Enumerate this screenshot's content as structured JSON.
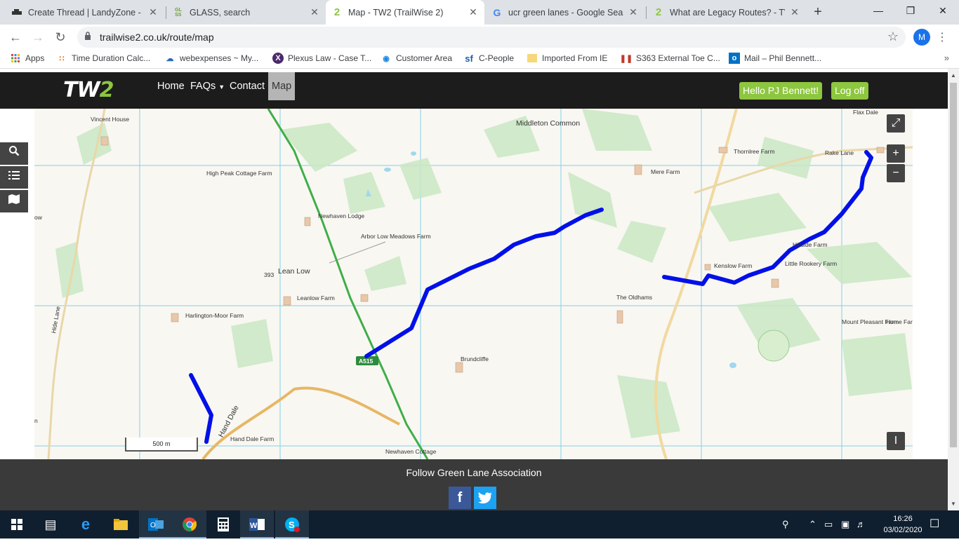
{
  "browser": {
    "tabs": [
      {
        "icon": "landrover-icon",
        "title": "Create Thread | LandyZone - La",
        "close": "✕"
      },
      {
        "icon": "glass-icon",
        "title": "GLASS, search",
        "close": "✕"
      },
      {
        "icon": "tw2-icon",
        "title": "Map - TW2 (TrailWise 2)",
        "close": "✕"
      },
      {
        "icon": "google-icon",
        "title": "ucr green lanes - Google Searc",
        "close": "✕"
      },
      {
        "icon": "tw2-icon",
        "title": "What are Legacy Routes? - TW",
        "close": "✕"
      }
    ],
    "new_tab": "+",
    "url": "trailwise2.co.uk/route/map",
    "profile_initial": "M",
    "bookmarks": [
      "Apps",
      "Time Duration Calc...",
      "webexpenses ~ My...",
      "Plexus Law - Case T...",
      "Customer Area",
      "C-People",
      "Imported From IE",
      "S363 External Toe C...",
      "Mail – Phil Bennett..."
    ]
  },
  "site": {
    "logo": {
      "part1": "TW",
      "part2": "2"
    },
    "nav": {
      "home": "Home",
      "faqs": "FAQs",
      "contact": "Contact",
      "map": "Map"
    },
    "greeting": "Hello PJ Bennett!",
    "logoff": "Log off",
    "footer": "Follow Green Lane Association",
    "social": {
      "facebook": "f",
      "twitter": "t"
    }
  },
  "map": {
    "labels": [
      "Vincent House",
      "High Peak Cottage Farm",
      "Middleton Common",
      "Thornlree Farm",
      "Rake Lane",
      "Mere Farm",
      "Flax Dale",
      "Newhaven Lodge",
      "Arbor Low Meadows Farm",
      "Lean Low",
      "393",
      "Leanlow Farm",
      "Harlington-Moor Farm",
      "The Oldhams",
      "Kenslow Farm",
      "Little Rookery Farm",
      "Hillside Farm",
      "Mount Pleasant Farm",
      "Home Farm",
      "Brundcliffe",
      "A515",
      "Hand Dale",
      "Hand Dale Farm",
      "Newhaven Cottage",
      "Hide Lane",
      "ow",
      "n"
    ],
    "scale": "500 m",
    "controls": {
      "fullscreen": "⤢",
      "zoom_in": "+",
      "zoom_out": "−",
      "info": "I"
    }
  },
  "taskbar": {
    "time": "16:26",
    "date": "03/02/2020"
  }
}
